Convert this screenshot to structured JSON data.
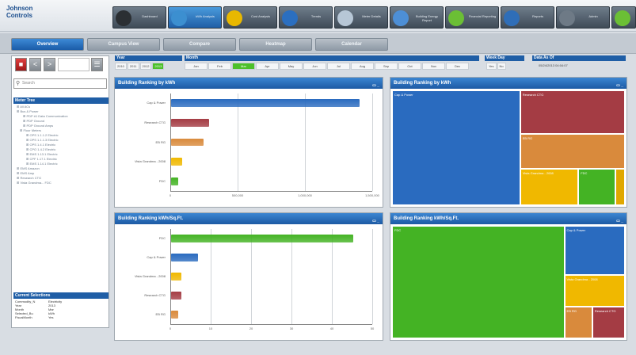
{
  "app": {
    "logo_line1": "Johnson",
    "logo_line2": "Controls"
  },
  "nav": [
    {
      "label": "Dashboard",
      "icon": "gauge-icon",
      "color": "#2b2f33",
      "active": false
    },
    {
      "label": "kWh Analysis",
      "icon": "globe-icon",
      "color": "#3c8fd0",
      "active": true
    },
    {
      "label": "Cost Analysis",
      "icon": "coin-icon",
      "color": "#e8b800",
      "active": false
    },
    {
      "label": "Trends",
      "icon": "trend-icon",
      "color": "#2b6fc0",
      "active": false
    },
    {
      "label": "Meter Details",
      "icon": "meter-icon",
      "color": "#b7c7d6",
      "active": false
    },
    {
      "label": "Building Energy Report",
      "icon": "building-icon",
      "color": "#4d8fd6",
      "active": false
    },
    {
      "label": "Financial Reporting",
      "icon": "bars-icon",
      "color": "#6bbf35",
      "active": false
    },
    {
      "label": "Reports",
      "icon": "report-icon",
      "color": "#2f6eb8",
      "active": false
    },
    {
      "label": "Admin",
      "icon": "chart-icon",
      "color": "#6e7a86",
      "active": false
    },
    {
      "label": "Help",
      "icon": "help-icon",
      "color": "#6bbf35",
      "active": false
    }
  ],
  "tabs": [
    {
      "label": "Overview",
      "active": true
    },
    {
      "label": "Campus View",
      "active": false
    },
    {
      "label": "Compare",
      "active": false
    },
    {
      "label": "Heatmap",
      "active": false
    },
    {
      "label": "Calendar",
      "active": false
    }
  ],
  "search": {
    "placeholder": "Search"
  },
  "meter_tree": {
    "title": "Meter Tree",
    "items": [
      "All ACs",
      "Bus & Power",
      "PDP #1 Data Communication",
      "PDP Ground",
      "PDP Ground Amps",
      "Floor Meters",
      "OPS 1.1.1.2 Electric",
      "OPS 1.1.1.3 Electric",
      "OPS 1.4.1 Electric",
      "CPO 1.4.2 Electric",
      "EMS 1.13.1 Electric",
      "CPF 1.17.1 Electric",
      "EMS 1.14.1 Electric",
      "EMS Amazon",
      "EMS Amp",
      "Research CTG",
      "Vista Grandma... FDC"
    ]
  },
  "filters": {
    "year": {
      "title": "Year",
      "values": [
        "2010",
        "2011",
        "2012",
        "2013"
      ],
      "selected": "2013"
    },
    "month": {
      "title": "Month",
      "values": [
        "Jan",
        "Feb",
        "Mar",
        "Apr",
        "May",
        "Jun",
        "Jul",
        "Aug",
        "Sep",
        "Oct",
        "Nov",
        "Dec"
      ],
      "selected": "Mar"
    },
    "weekday": {
      "title": "Week Day",
      "values": [
        "Yes",
        "No"
      ]
    },
    "data_asof": {
      "title": "Data As Of",
      "value": "05/24/2013 04:04:07"
    }
  },
  "current_selections": {
    "title": "Current Selections",
    "rows": [
      [
        "Commodity_N",
        "Electricity"
      ],
      [
        "Year",
        "2013"
      ],
      [
        "Month",
        "Mar"
      ],
      [
        "Selected_Bu",
        "kWh"
      ],
      [
        "FiscalMonth",
        "Yes"
      ]
    ]
  },
  "panels": {
    "p1": {
      "title": "Building Ranking by kWh"
    },
    "p2": {
      "title": "Building Ranking by kWh"
    },
    "p3": {
      "title": "Building Ranking kWh/Sq.Ft."
    },
    "p4": {
      "title": "Building Ranking kWh/Sq.Ft."
    }
  },
  "chart_data": [
    {
      "type": "bar",
      "title": "Building Ranking by kWh",
      "categories": [
        "Cap & Power",
        "Research CTG",
        "EB RG",
        "Vista Grandma - 2008",
        "FDC"
      ],
      "values": [
        1400000,
        280000,
        240000,
        80000,
        50000
      ],
      "colors": [
        "#2a6bbf",
        "#a43c44",
        "#d98a3c",
        "#f0b800",
        "#44b324"
      ],
      "xticks": [
        "0",
        "500,000",
        "1,000,000",
        "1,500,000"
      ],
      "xlim": [
        0,
        1500000
      ]
    },
    {
      "type": "heatmap",
      "title": "Building Ranking by kWh",
      "cells": [
        {
          "label": "Cap & Power",
          "color": "#2a6bbf"
        },
        {
          "label": "Research CTG",
          "color": "#a43c44"
        },
        {
          "label": "EB RG",
          "color": "#d98a3c"
        },
        {
          "label": "Vista Grandma - 2008",
          "color": "#f0b800"
        },
        {
          "label": "FDC",
          "color": "#44b324"
        },
        {
          "label": "",
          "color": "#e0a800"
        }
      ]
    },
    {
      "type": "bar",
      "title": "Building Ranking kWh/Sq.Ft.",
      "categories": [
        "FDC",
        "Cap & Power",
        "Vista Grandma - 2008",
        "Research CTG",
        "EB RG"
      ],
      "values": [
        54,
        8,
        3,
        3,
        2
      ],
      "colors": [
        "#44b324",
        "#2a6bbf",
        "#f0b800",
        "#a43c44",
        "#d98a3c"
      ],
      "xticks": [
        "0",
        "10",
        "20",
        "30",
        "40",
        "50"
      ],
      "xlim": [
        0,
        60
      ]
    },
    {
      "type": "heatmap",
      "title": "Building Ranking kWh/Sq.Ft.",
      "cells": [
        {
          "label": "FDC",
          "color": "#44b324"
        },
        {
          "label": "Cap & Power",
          "color": "#2a6bbf"
        },
        {
          "label": "Vista Grandma - 2008",
          "color": "#f0b800"
        },
        {
          "label": "EB RG",
          "color": "#d98a3c"
        },
        {
          "label": "Research CTG",
          "color": "#a43c44"
        }
      ]
    }
  ]
}
